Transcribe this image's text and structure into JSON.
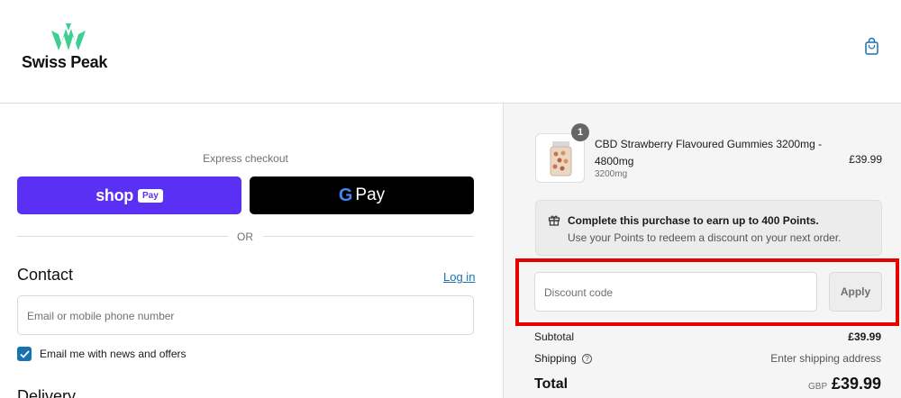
{
  "header": {
    "brand": "Swiss Peak",
    "bag_icon": "shopping-bag-icon"
  },
  "express": {
    "label": "Express checkout",
    "shop_pay": {
      "word": "shop",
      "badge": "Pay"
    },
    "google_pay": {
      "letter": "G",
      "word": "Pay"
    },
    "or_label": "OR"
  },
  "contact": {
    "title": "Contact",
    "login_link": "Log in",
    "email_placeholder": "Email or mobile phone number",
    "newsletter_label": "Email me with news and offers",
    "newsletter_checked": true
  },
  "delivery": {
    "title": "Delivery"
  },
  "summary": {
    "item": {
      "quantity": "1",
      "name": "CBD Strawberry Flavoured Gummies 3200mg - 4800mg",
      "variant": "3200mg",
      "price": "£39.99"
    },
    "points": {
      "title": "Complete this purchase to earn up to 400 Points.",
      "subtitle": "Use your Points to redeem a discount on your next order."
    },
    "discount": {
      "placeholder": "Discount code",
      "apply_label": "Apply"
    },
    "subtotal": {
      "label": "Subtotal",
      "value": "£39.99"
    },
    "shipping": {
      "label": "Shipping",
      "value": "Enter shipping address"
    },
    "total": {
      "label": "Total",
      "currency": "GBP",
      "value": "£39.99"
    }
  },
  "colors": {
    "shop_pay": "#5a31f4",
    "google_pay": "#000000",
    "link": "#1773b0",
    "highlight": "#e60000",
    "brand_green": "#3ccf91"
  }
}
